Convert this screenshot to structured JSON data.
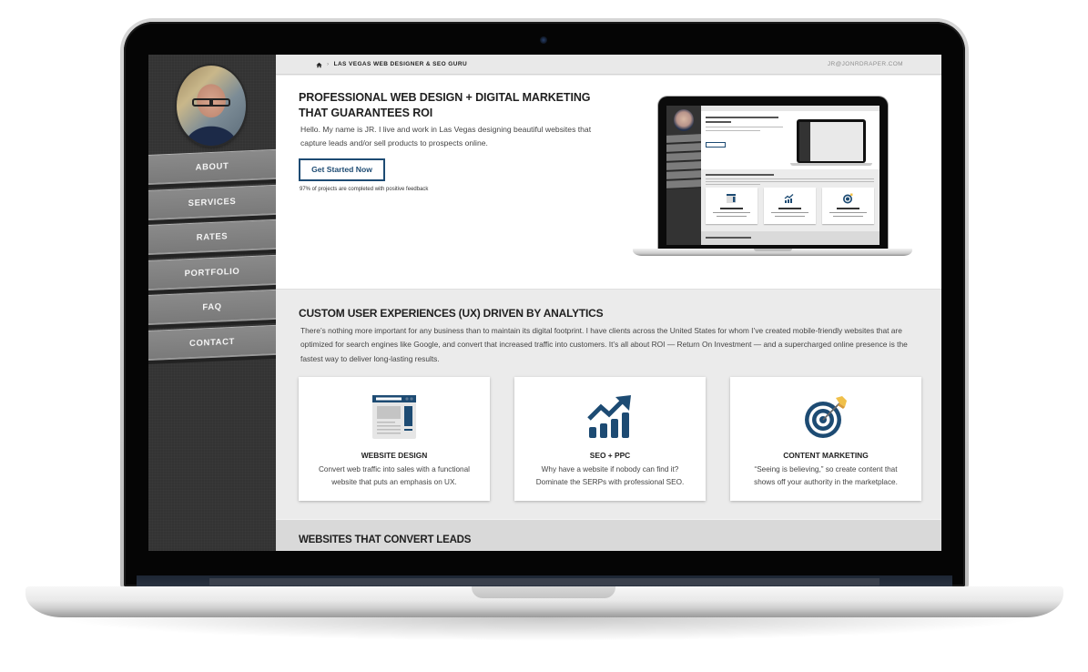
{
  "topbar": {
    "home_icon": "home-icon",
    "breadcrumb_separator": "›",
    "breadcrumb": "LAS VEGAS WEB DESIGNER & SEO GURU",
    "email": "JR@JONRDRAPER.COM"
  },
  "sidebar": {
    "avatar": "profile-photo",
    "items": [
      {
        "label": "ABOUT"
      },
      {
        "label": "SERVICES"
      },
      {
        "label": "RATES"
      },
      {
        "label": "PORTFOLIO"
      },
      {
        "label": "FAQ"
      },
      {
        "label": "CONTACT"
      }
    ]
  },
  "hero": {
    "title": "PROFESSIONAL WEB DESIGN + DIGITAL MARKETING THAT GUARANTEES ROI",
    "intro": "Hello. My name is JR. I live and work in Las Vegas designing beautiful websites that capture leads and/or sell products to prospects online.",
    "cta_label": "Get Started Now",
    "note": "97% of projects are completed with positive feedback",
    "preview_image": "laptop-preview-of-site"
  },
  "ux": {
    "title": "CUSTOM USER EXPERIENCES (UX) DRIVEN BY ANALYTICS",
    "text": "There’s nothing more important for any business than to maintain its digital footprint. I have clients across the United States for whom I’ve created mobile-friendly websites that are optimized for search engines like Google, and convert that increased traffic into customers. It’s all about ROI — Return On Investment — and a supercharged online presence is the fastest way to deliver long-lasting results.",
    "cards": [
      {
        "icon": "browser-window-icon",
        "title": "WEBSITE DESIGN",
        "text": "Convert web traffic into sales with a functional website that puts an emphasis on UX."
      },
      {
        "icon": "growth-chart-icon",
        "title": "SEO + PPC",
        "text": "Why have a website if nobody can find it? Dominate the SERPs with professional SEO."
      },
      {
        "icon": "target-arrow-icon",
        "title": "CONTENT MARKETING",
        "text": "“Seeing is believing,” so create content that shows off your authority in the marketplace."
      }
    ]
  },
  "leads": {
    "title": "WEBSITES THAT CONVERT LEADS"
  },
  "colors": {
    "brand_blue": "#1d4b73",
    "sidebar_bg": "#333333",
    "nav_item_bg": "#7f7f7f",
    "accent_yellow": "#f0c04a"
  }
}
